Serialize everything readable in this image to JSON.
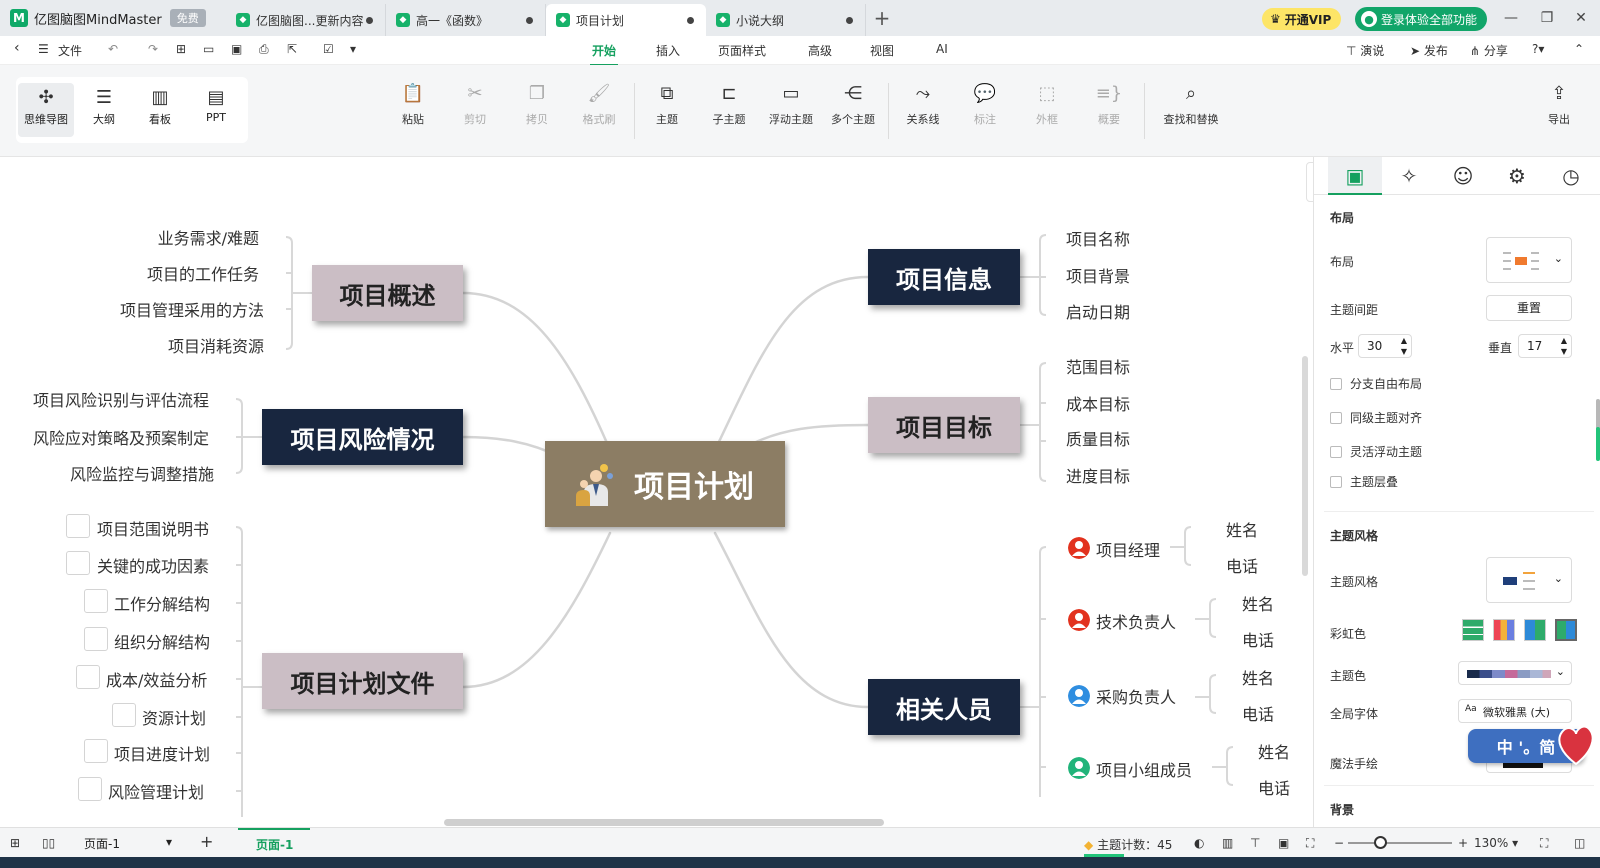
{
  "titlebar": {
    "app_name": "亿图脑图MindMaster",
    "app_badge": "免费",
    "tabs": [
      {
        "label": "亿图脑图...更新内容"
      },
      {
        "label": "高一《函数》"
      },
      {
        "label": "项目计划"
      },
      {
        "label": "小说大纲"
      }
    ],
    "vip_label": "开通VIP",
    "login_label": "登录体验全部功能"
  },
  "menubar": {
    "file_label": "文件",
    "tabs": [
      "开始",
      "插入",
      "页面样式",
      "高级",
      "视图",
      "AI"
    ],
    "right": {
      "present": "演说",
      "publish": "发布",
      "share": "分享"
    }
  },
  "toolbar": {
    "views": [
      "思维导图",
      "大纲",
      "看板",
      "PPT"
    ],
    "buttons": [
      "粘贴",
      "剪切",
      "拷贝",
      "格式刷",
      "主题",
      "子主题",
      "浮动主题",
      "多个主题",
      "关系线",
      "标注",
      "外框",
      "概要",
      "查找和替换"
    ],
    "export_label": "导出"
  },
  "mindmap": {
    "root": "项目计划",
    "right_topics": [
      {
        "label": "项目信息",
        "children": [
          "项目名称",
          "项目背景",
          "启动日期"
        ]
      },
      {
        "label": "项目目标",
        "children": [
          "范围目标",
          "成本目标",
          "质量目标",
          "进度目标"
        ]
      },
      {
        "label": "相关人员",
        "children": [
          {
            "label": "项目经理",
            "children": [
              "姓名",
              "电话"
            ]
          },
          {
            "label": "技术负责人",
            "children": [
              "姓名",
              "电话"
            ]
          },
          {
            "label": "采购负责人",
            "children": [
              "姓名",
              "电话"
            ]
          },
          {
            "label": "项目小组成员",
            "children": [
              "姓名",
              "电话"
            ]
          }
        ]
      }
    ],
    "left_topics": [
      {
        "label": "项目概述",
        "children": [
          "业务需求/难题",
          "项目的工作任务",
          "项目管理采用的方法",
          "项目消耗资源"
        ]
      },
      {
        "label": "项目风险情况",
        "children": [
          "项目风险识别与评估流程",
          "风险应对策略及预案制定",
          "风险监控与调整措施"
        ]
      },
      {
        "label": "项目计划文件",
        "children": [
          "项目范围说明书",
          "关键的成功因素",
          "工作分解结构",
          "组织分解结构",
          "成本/效益分析",
          "资源计划",
          "项目进度计划",
          "风险管理计划"
        ]
      }
    ],
    "colors": {
      "root": "#8c7d64",
      "dark_topic": "#18263f",
      "light_topic": "#cbbec5",
      "line": "#d4d4d4"
    }
  },
  "panel": {
    "layout_section": "布局",
    "layout_label": "布局",
    "spacing_label": "主题间距",
    "reset_label": "重置",
    "horizontal_label": "水平",
    "horizontal_value": "30",
    "vertical_label": "垂直",
    "vertical_value": "17",
    "checkboxes": [
      "分支自由布局",
      "同级主题对齐",
      "灵活浮动主题",
      "主题层叠"
    ],
    "style_section": "主题风格",
    "style_label": "主题风格",
    "rainbow_label": "彩虹色",
    "theme_color_label": "主题色",
    "font_label": "全局字体",
    "font_value": "微软雅黑 (大)",
    "magic_label": "魔法手绘",
    "background_section": "背景"
  },
  "statusbar": {
    "page_select": "页面-1",
    "page_tab": "页面-1",
    "topic_count_label": "主题计数：45",
    "zoom": "130%"
  },
  "ime": {
    "label": "中 '。简"
  }
}
